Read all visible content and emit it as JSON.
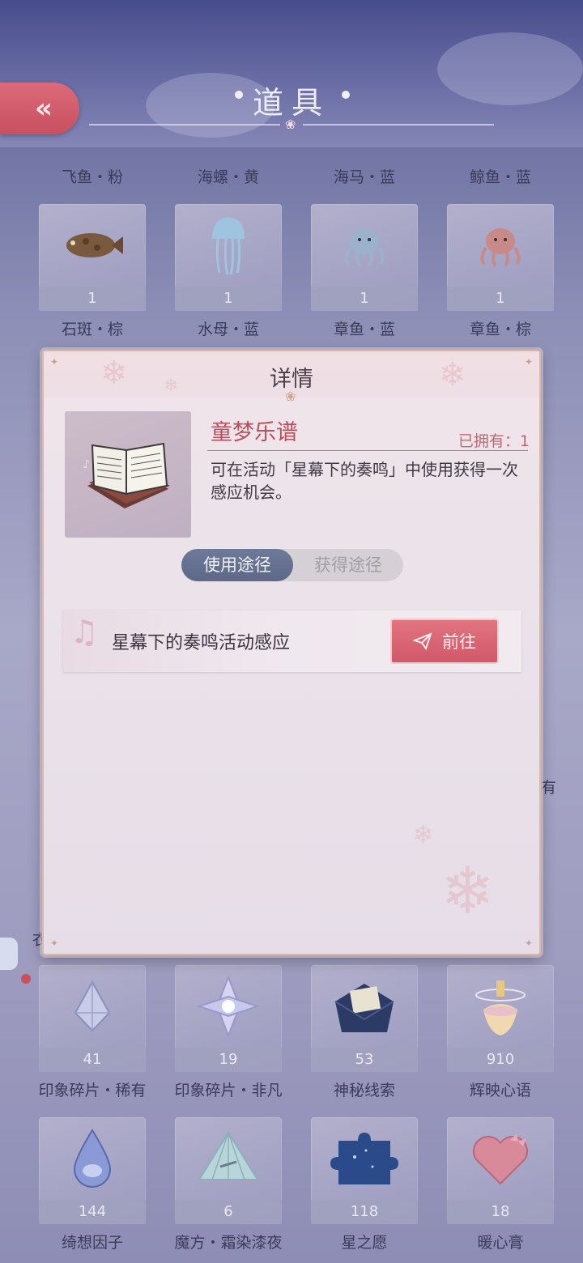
{
  "header": {
    "title": "道具",
    "back_label": "«"
  },
  "grid": {
    "top_labels": [
      "飞鱼・粉",
      "海螺・黄",
      "海马・蓝",
      "鲸鱼・蓝"
    ],
    "row1": [
      {
        "count": "1",
        "label": "石斑・棕",
        "icon": "grouper-fish-icon"
      },
      {
        "count": "1",
        "label": "水母・蓝",
        "icon": "jellyfish-icon"
      },
      {
        "count": "1",
        "label": "章鱼・蓝",
        "icon": "octopus-blue-icon"
      },
      {
        "count": "1",
        "label": "章鱼・棕",
        "icon": "octopus-brown-icon"
      }
    ],
    "row_bottom_a": [
      {
        "count": "41",
        "label": "印象碎片・稀有",
        "icon": "crystal-shard-icon"
      },
      {
        "count": "19",
        "label": "印象碎片・非凡",
        "icon": "star-crystal-icon"
      },
      {
        "count": "53",
        "label": "神秘线索",
        "icon": "mystery-envelope-icon"
      },
      {
        "count": "910",
        "label": "辉映心语",
        "icon": "perfume-bottle-icon"
      }
    ],
    "row_bottom_b": [
      {
        "count": "144",
        "label": "绮想因子",
        "icon": "water-drop-icon"
      },
      {
        "count": "6",
        "label": "魔方・霜染漆夜",
        "icon": "pyramid-crystal-icon"
      },
      {
        "count": "118",
        "label": "星之愿",
        "icon": "puzzle-piece-icon"
      },
      {
        "count": "18",
        "label": "暖心膏",
        "icon": "heart-box-icon"
      }
    ],
    "side_text_right": "有",
    "side_text_left": "衣"
  },
  "modal": {
    "title": "详情",
    "item_name": "童梦乐谱",
    "owned": "已拥有：1",
    "description": "可在活动「星幕下的奏鸣」中使用获得一次感应机会。",
    "tabs": [
      {
        "label": "使用途径",
        "active": true
      },
      {
        "label": "获得途径",
        "active": false
      }
    ],
    "source": {
      "label": "星幕下的奏鸣活动感应",
      "button_label": "前往"
    }
  },
  "colors": {
    "accent_red": "#d05868",
    "item_name": "#b8505e",
    "tab_active": "#5d6887"
  }
}
